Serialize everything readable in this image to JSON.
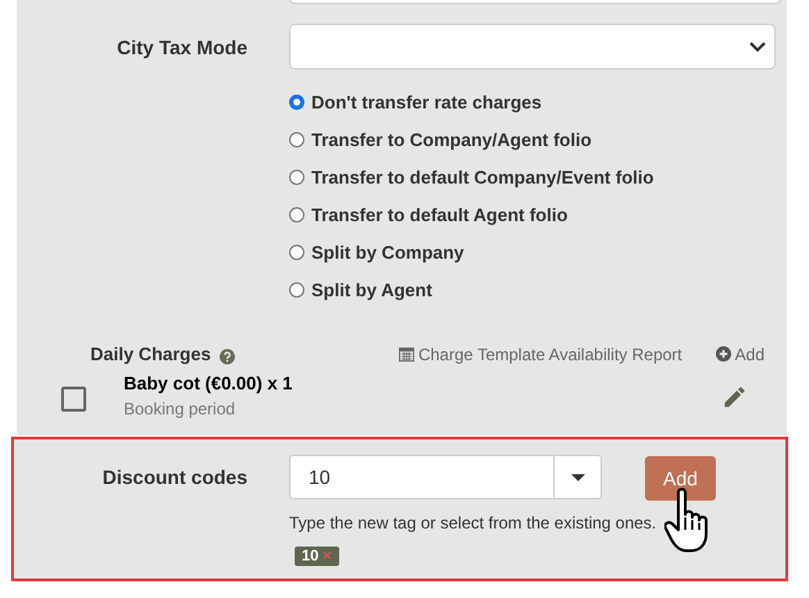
{
  "city_tax_mode": {
    "label": "City Tax Mode"
  },
  "transfer_options": [
    {
      "label": "Don't transfer rate charges",
      "selected": true
    },
    {
      "label": "Transfer to Company/Agent folio",
      "selected": false
    },
    {
      "label": "Transfer to default Company/Event folio",
      "selected": false
    },
    {
      "label": "Transfer to default Agent folio",
      "selected": false
    },
    {
      "label": "Split by Company",
      "selected": false
    },
    {
      "label": "Split by Agent",
      "selected": false
    }
  ],
  "daily_charges": {
    "title": "Daily Charges",
    "report_link": "Charge Template Availability Report",
    "add_link": "Add",
    "items": [
      {
        "name": "Baby cot (€0.00) x 1",
        "period": "Booking period",
        "checked": false
      }
    ]
  },
  "discount_codes": {
    "label": "Discount codes",
    "value": "10",
    "add_button": "Add",
    "help": "Type the new tag or select from the existing ones.",
    "tags": [
      {
        "label": "10",
        "remove": "×"
      }
    ]
  }
}
